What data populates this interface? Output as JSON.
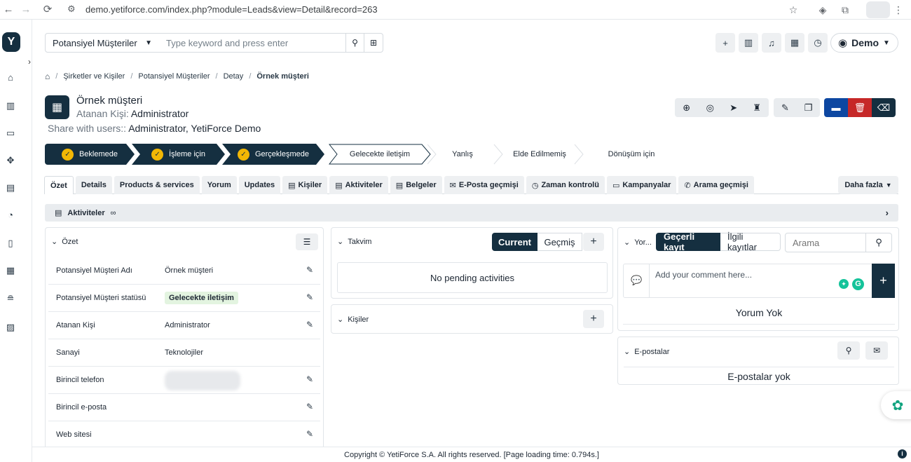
{
  "browser": {
    "url": "demo.yetiforce.com/index.php?module=Leads&view=Detail&record=263"
  },
  "logo": {
    "letter": "Y"
  },
  "header": {
    "module_select": "Potansiyel Müşteriler",
    "search_placeholder": "Type keyword and press enter",
    "user_label": "Demo"
  },
  "breadcrumb": [
    "Şirketler ve Kişiler",
    "Potansiyel Müşteriler",
    "Detay",
    "Örnek müşteri"
  ],
  "record": {
    "title": "Örnek müşteri",
    "assigned_label": "Atanan Kişi:",
    "assigned_value": "Administrator",
    "share_label": "Share with users::",
    "share_value": "Administrator, YetiForce Demo"
  },
  "pipeline": [
    {
      "label": "Beklemede",
      "state": "done"
    },
    {
      "label": "İşleme için",
      "state": "done"
    },
    {
      "label": "Gerçekleşmede",
      "state": "done"
    },
    {
      "label": "Gelecekte iletişim",
      "state": "current"
    },
    {
      "label": "Yanlış",
      "state": "todo"
    },
    {
      "label": "Elde Edilmemiş",
      "state": "todo"
    },
    {
      "label": "Dönüşüm için",
      "state": "todo"
    }
  ],
  "tabs": [
    {
      "label": "Özet",
      "active": true
    },
    {
      "label": "Details"
    },
    {
      "label": "Products & services"
    },
    {
      "label": "Yorum"
    },
    {
      "label": "Updates"
    },
    {
      "label": "Kişiler"
    },
    {
      "label": "Aktiviteler"
    },
    {
      "label": "Belgeler"
    },
    {
      "label": "E-Posta geçmişi"
    },
    {
      "label": "Zaman kontrolü"
    },
    {
      "label": "Kampanyalar"
    },
    {
      "label": "Arama geçmişi"
    }
  ],
  "more_tab": "Daha fazla",
  "activities_bar": "Aktiviteler",
  "summary": {
    "title": "Özet",
    "fields": [
      {
        "label": "Potansiyel Müşteri Adı",
        "value": "Örnek müşteri",
        "editable": true
      },
      {
        "label": "Potansiyel Müşteri statüsü",
        "value": "Gelecekte iletişim",
        "badge": true,
        "editable": true
      },
      {
        "label": "Atanan Kişi",
        "value": "Administrator",
        "editable": true
      },
      {
        "label": "Sanayi",
        "value": "Teknolojiler",
        "editable": false
      },
      {
        "label": "Birincil telefon",
        "value": "",
        "blurred": true,
        "editable": true
      },
      {
        "label": "Birincil e-posta",
        "value": "",
        "editable": true
      },
      {
        "label": "Web sitesi",
        "value": "",
        "editable": true
      }
    ]
  },
  "calendar": {
    "title": "Takvim",
    "seg_current": "Current",
    "seg_past": "Geçmiş",
    "empty": "No pending activities"
  },
  "people": {
    "title": "Kişiler"
  },
  "comments": {
    "title": "Yor...",
    "seg_current": "Geçerli kayıt",
    "seg_related": "İlgili kayıtlar",
    "search_placeholder": "Arama",
    "input_placeholder": "Add your comment here...",
    "empty": "Yorum Yok"
  },
  "emails": {
    "title": "E-postalar",
    "empty": "E-postalar yok"
  },
  "footer": "Copyright © YetiForce S.A. All rights reserved. [Page loading time: 0.794s.]",
  "colors": {
    "brand_dark": "#152f40",
    "check_yellow": "#f2b705",
    "archive_blue": "#0d47a1",
    "delete_red": "#c62828",
    "badge_green_bg": "#e3f4e0"
  }
}
